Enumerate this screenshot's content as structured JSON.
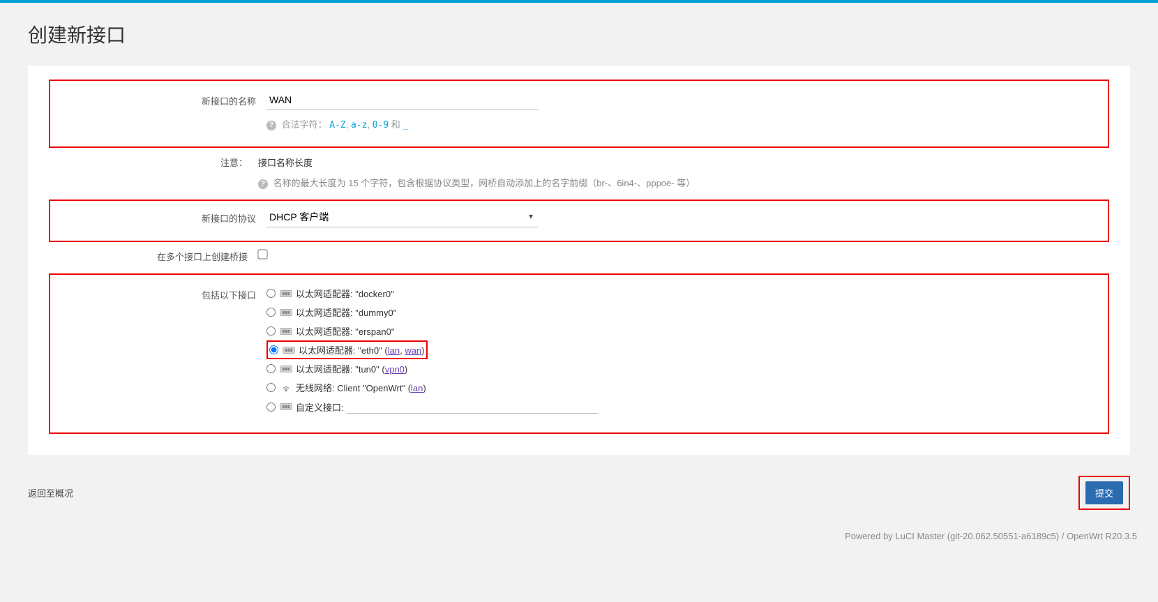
{
  "title": "创建新接口",
  "fields": {
    "name": {
      "label": "新接口的名称",
      "value": "WAN",
      "hint_prefix": "合法字符：",
      "hint_codes": [
        "A-Z",
        "a-z",
        "0-9"
      ],
      "hint_joiner": ", ",
      "hint_and": " 和 ",
      "hint_last": "_"
    },
    "note": {
      "label": "注意：",
      "value_text": "接口名称长度",
      "hint": "名称的最大长度为 15 个字符，包含根据协议类型，网桥自动添加上的名字前缀（br-、6in4-、pppoe- 等）"
    },
    "protocol": {
      "label": "新接口的协议",
      "selected": "DHCP 客户端"
    },
    "bridge": {
      "label": "在多个接口上创建桥接",
      "checked": false
    },
    "interfaces": {
      "label": "包括以下接口",
      "adapter_prefix": "以太网适配器: ",
      "wireless_prefix": "无线网络: ",
      "custom_label": "自定义接口:",
      "items": [
        {
          "type": "eth",
          "name": "docker0",
          "selected": false,
          "zones": []
        },
        {
          "type": "eth",
          "name": "dummy0",
          "selected": false,
          "zones": []
        },
        {
          "type": "eth",
          "name": "erspan0",
          "selected": false,
          "zones": []
        },
        {
          "type": "eth",
          "name": "eth0",
          "selected": true,
          "zones": [
            "lan",
            "wan"
          ]
        },
        {
          "type": "eth",
          "name": "tun0",
          "selected": false,
          "zones": [
            "vpn0"
          ]
        },
        {
          "type": "wifi",
          "name": "Client \"OpenWrt\"",
          "selected": false,
          "zones": [
            "lan"
          ]
        }
      ]
    }
  },
  "footer": {
    "back": "返回至概况",
    "submit": "提交"
  },
  "powered": "Powered by LuCI Master (git-20.062.50551-a6189c5) / OpenWrt R20.3.5"
}
